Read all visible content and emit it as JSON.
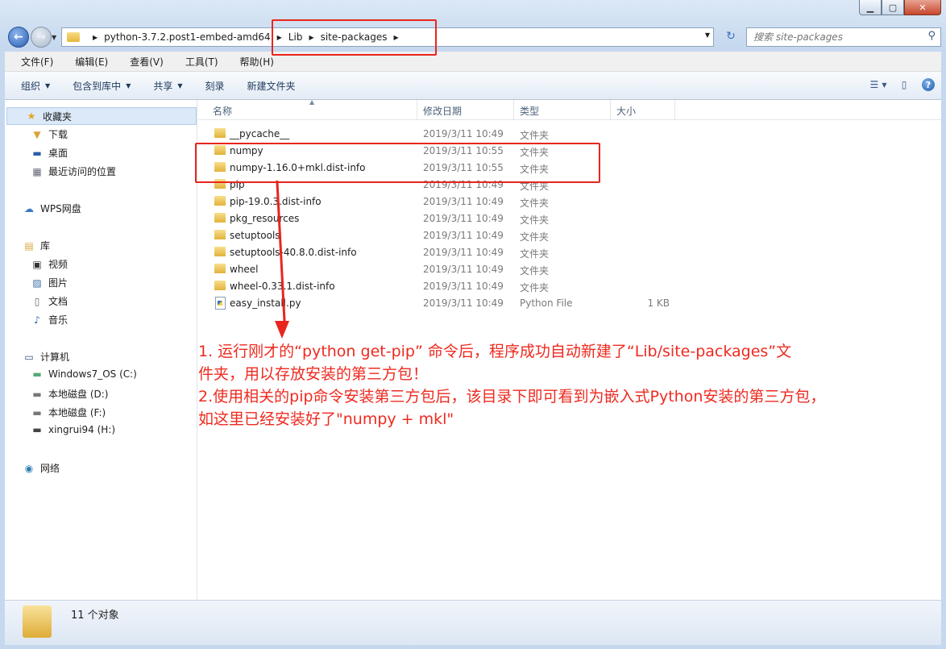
{
  "window": {
    "caption_min": "▁",
    "caption_max": "▢",
    "caption_close": "✕"
  },
  "nav": {
    "back_glyph": "←",
    "forward_glyph": "→",
    "refresh_glyph": "↻",
    "breadcrumbs": [
      "python-3.7.2.post1-embed-amd64",
      "Lib",
      "site-packages"
    ],
    "search_placeholder": "搜索 site-packages"
  },
  "menu": [
    "文件(F)",
    "编辑(E)",
    "查看(V)",
    "工具(T)",
    "帮助(H)"
  ],
  "toolbar": {
    "organize": "组织",
    "include_library": "包含到库中",
    "share": "共享",
    "burn": "刻录",
    "new_folder": "新建文件夹"
  },
  "sidebar": {
    "favorites": "收藏夹",
    "downloads": "下载",
    "desktop": "桌面",
    "recent": "最近访问的位置",
    "wps": "WPS网盘",
    "library": "库",
    "videos": "视频",
    "pictures": "图片",
    "documents": "文档",
    "music": "音乐",
    "computer": "计算机",
    "drive_c": "Windows7_OS (C:)",
    "drive_d": "本地磁盘 (D:)",
    "drive_f": "本地磁盘 (F:)",
    "drive_h": "xingrui94 (H:)",
    "network": "网络"
  },
  "columns": {
    "name": "名称",
    "date": "修改日期",
    "type": "类型",
    "size": "大小"
  },
  "files": [
    {
      "name": "__pycache__",
      "date": "2019/3/11 10:49",
      "type": "文件夹",
      "size": "",
      "kind": "folder"
    },
    {
      "name": "numpy",
      "date": "2019/3/11 10:55",
      "type": "文件夹",
      "size": "",
      "kind": "folder"
    },
    {
      "name": "numpy-1.16.0+mkl.dist-info",
      "date": "2019/3/11 10:55",
      "type": "文件夹",
      "size": "",
      "kind": "folder"
    },
    {
      "name": "pip",
      "date": "2019/3/11 10:49",
      "type": "文件夹",
      "size": "",
      "kind": "folder"
    },
    {
      "name": "pip-19.0.3.dist-info",
      "date": "2019/3/11 10:49",
      "type": "文件夹",
      "size": "",
      "kind": "folder"
    },
    {
      "name": "pkg_resources",
      "date": "2019/3/11 10:49",
      "type": "文件夹",
      "size": "",
      "kind": "folder"
    },
    {
      "name": "setuptools",
      "date": "2019/3/11 10:49",
      "type": "文件夹",
      "size": "",
      "kind": "folder"
    },
    {
      "name": "setuptools-40.8.0.dist-info",
      "date": "2019/3/11 10:49",
      "type": "文件夹",
      "size": "",
      "kind": "folder"
    },
    {
      "name": "wheel",
      "date": "2019/3/11 10:49",
      "type": "文件夹",
      "size": "",
      "kind": "folder"
    },
    {
      "name": "wheel-0.33.1.dist-info",
      "date": "2019/3/11 10:49",
      "type": "文件夹",
      "size": "",
      "kind": "folder"
    },
    {
      "name": "easy_install.py",
      "date": "2019/3/11 10:49",
      "type": "Python File",
      "size": "1 KB",
      "kind": "python"
    }
  ],
  "status": {
    "count": "11 个对象"
  },
  "annotation": {
    "line1": "1. 运行刚才的“python get-pip” 命令后，程序成功自动新建了“Lib/site-packages”文",
    "line2": "件夹，用以存放安装的第三方包！",
    "line3": "2.使用相关的pip命令安装第三方包后，该目录下即可看到为嵌入式Python安装的第三方包，",
    "line4": "   如这里已经安装好了\"numpy + mkl\"",
    "color": "#ee2a20"
  }
}
